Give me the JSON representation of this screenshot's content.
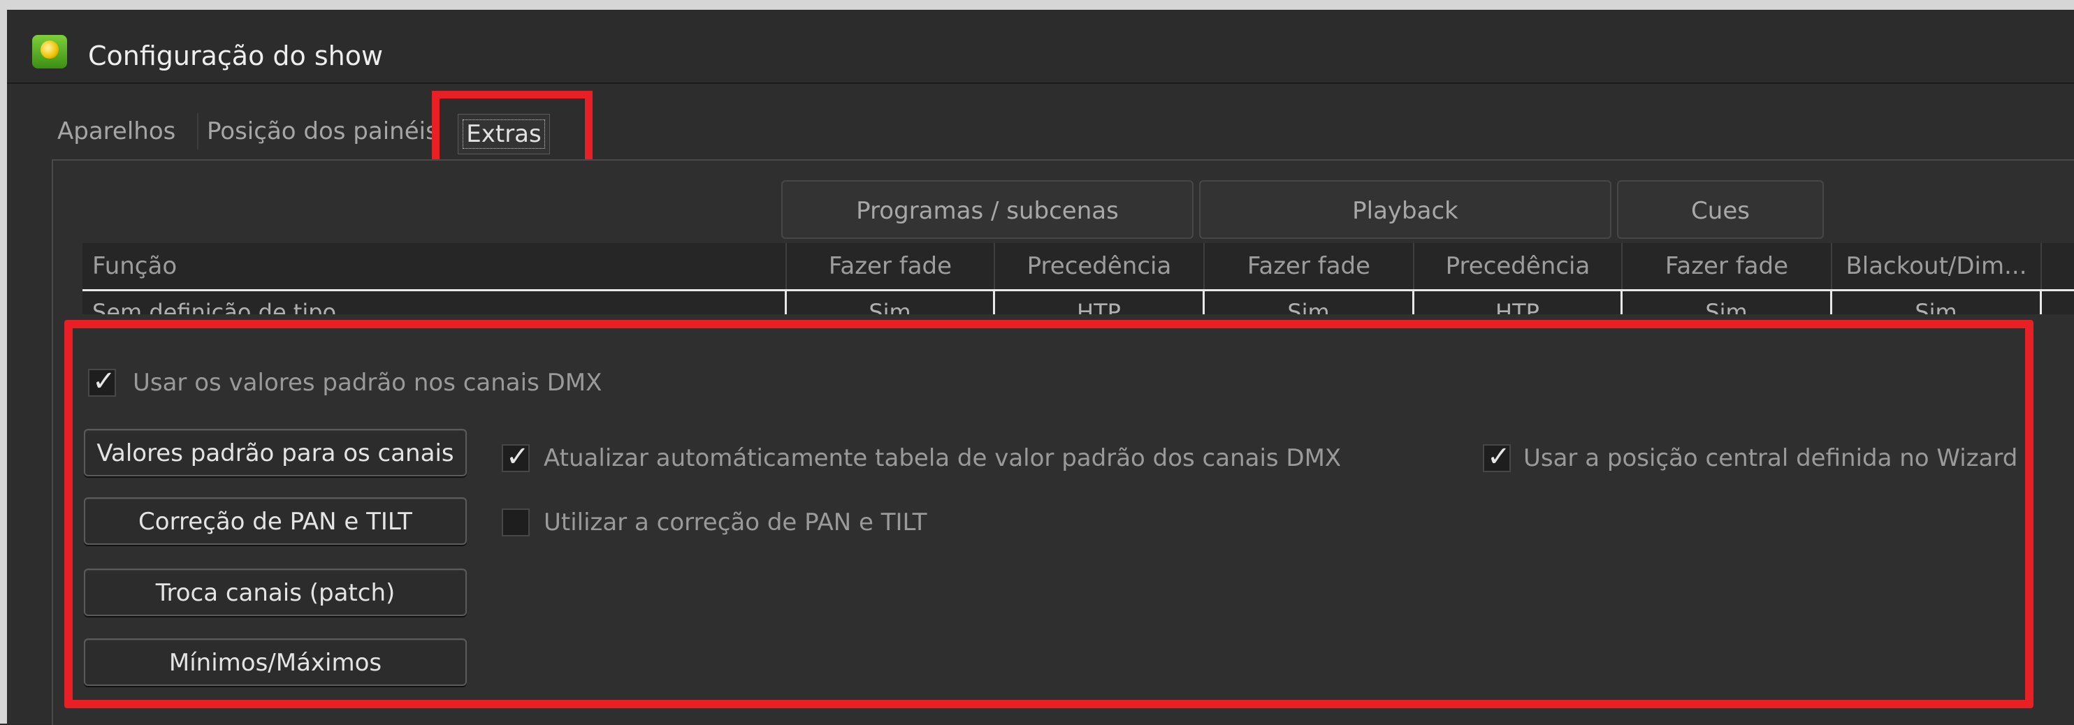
{
  "window": {
    "title": "Configuração do show"
  },
  "tabs": [
    {
      "label": "Aparelhos",
      "active": false
    },
    {
      "label": "Posição dos painéis",
      "active": false
    },
    {
      "label": "Extras",
      "active": true
    }
  ],
  "groups": [
    {
      "label": "Programas / subcenas"
    },
    {
      "label": "Playback"
    },
    {
      "label": "Cues"
    }
  ],
  "table": {
    "columns": [
      "Função",
      "Fazer fade",
      "Precedência",
      "Fazer fade",
      "Precedência",
      "Fazer fade",
      "Blackout/Dim..."
    ],
    "rows": [
      [
        "Sem definição de tipo",
        "Sim",
        "HTP",
        "Sim",
        "HTP",
        "Sim",
        "Sim"
      ]
    ]
  },
  "options": {
    "use_default_values": {
      "label": "Usar os valores padrão nos canais DMX",
      "checked": true
    },
    "auto_update_table": {
      "label": "Atualizar automáticamente tabela de valor padrão dos canais DMX",
      "checked": true
    },
    "use_pan_tilt_correction": {
      "label": "Utilizar a correção de PAN e TILT",
      "checked": false
    },
    "use_center_position": {
      "label": "Usar a posição central definida no Wizard",
      "checked": true
    }
  },
  "buttons": {
    "default_values": "Valores padrão para os canais",
    "pan_tilt_correction": "Correção de PAN e TILT",
    "patch": "Troca canais (patch)",
    "min_max": "Mínimos/Máximos"
  },
  "colors": {
    "highlight": "#e81f25",
    "background": "#2d2d2d"
  }
}
